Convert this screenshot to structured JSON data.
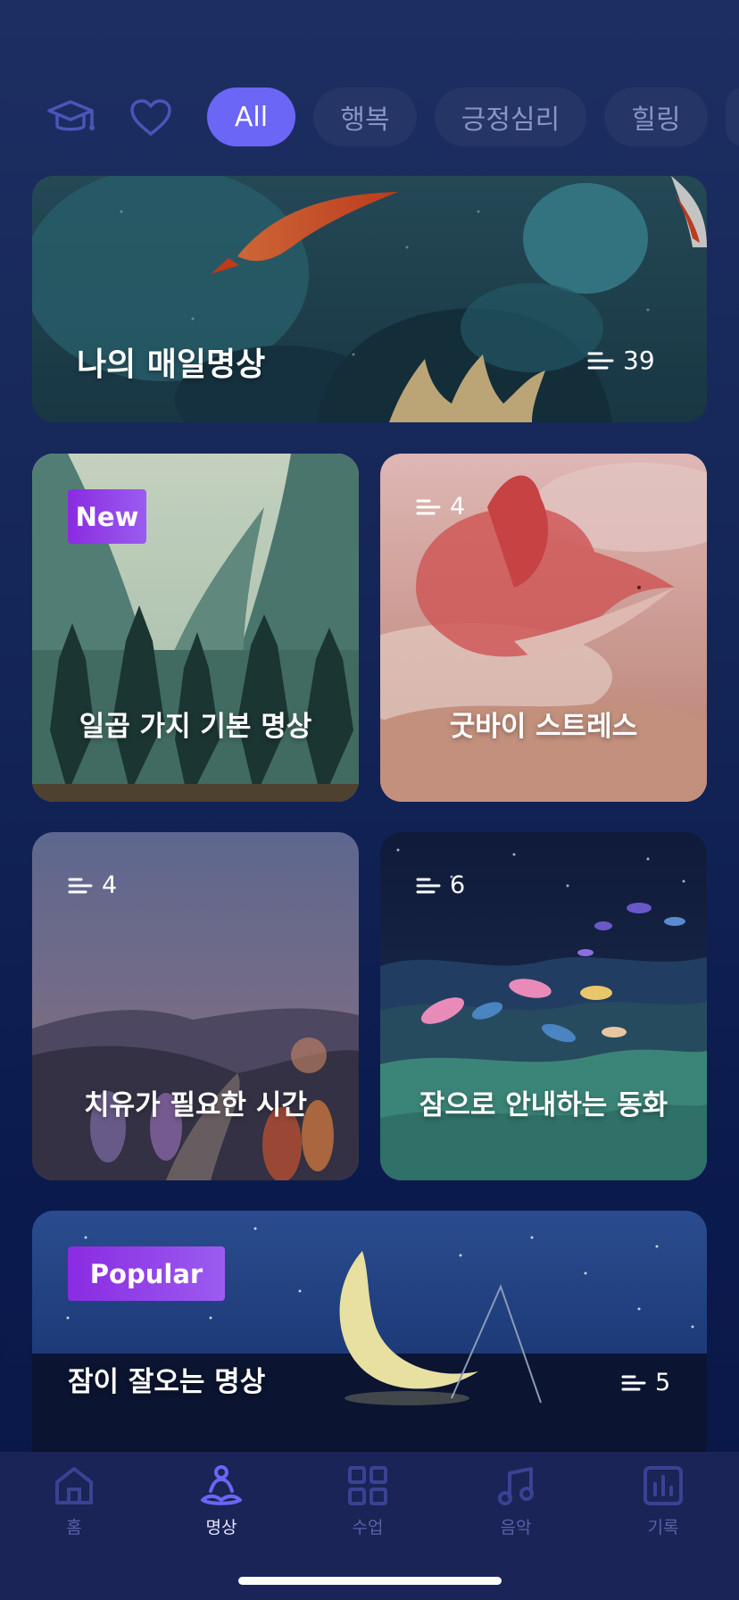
{
  "filters": {
    "icons": [
      "graduation-cap-icon",
      "heart-icon"
    ],
    "chips": [
      {
        "label": "All",
        "active": true
      },
      {
        "label": "행복",
        "active": false
      },
      {
        "label": "긍정심리",
        "active": false
      },
      {
        "label": "힐링",
        "active": false
      }
    ]
  },
  "cards": {
    "daily": {
      "title": "나의 매일명상",
      "count": "39"
    },
    "basic": {
      "title": "일곱 가지 기본 명상",
      "badge": "New"
    },
    "stress": {
      "title": "굿바이 스트레스",
      "count": "4"
    },
    "healing": {
      "title": "치유가 필요한 시간",
      "count": "4"
    },
    "sleep_story": {
      "title": "잠으로 안내하는 동화",
      "count": "6"
    },
    "sleep": {
      "title": "잠이 잘오는 명상",
      "count": "5",
      "badge": "Popular"
    }
  },
  "nav": {
    "items": [
      {
        "label": "홈",
        "icon": "home-icon",
        "active": false
      },
      {
        "label": "명상",
        "icon": "meditation-icon",
        "active": true
      },
      {
        "label": "수업",
        "icon": "grid-icon",
        "active": false
      },
      {
        "label": "음악",
        "icon": "music-note-icon",
        "active": false
      },
      {
        "label": "기록",
        "icon": "chart-icon",
        "active": false
      }
    ]
  },
  "colors": {
    "accent": "#6b66f5",
    "badge": "#8a2be2",
    "background": "#142557",
    "chip_inactive": "#243566",
    "nav_background": "#1a2456"
  }
}
